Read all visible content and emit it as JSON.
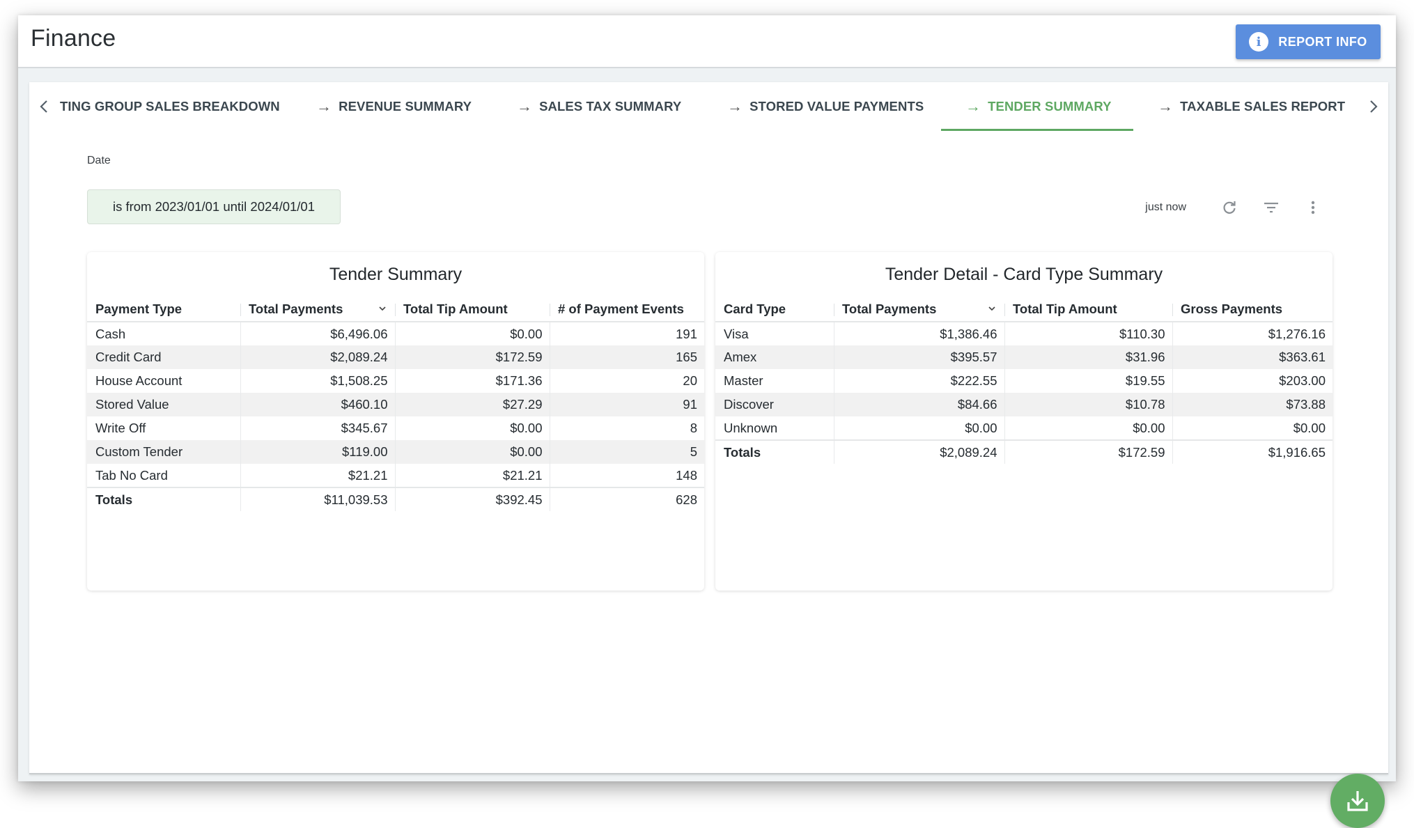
{
  "app": {
    "title": "Finance",
    "report_info_label": "REPORT INFO"
  },
  "tabs": [
    {
      "label": "TING GROUP SALES BREAKDOWN",
      "active": false
    },
    {
      "label": "REVENUE SUMMARY",
      "active": false
    },
    {
      "label": "SALES TAX SUMMARY",
      "active": false
    },
    {
      "label": "STORED VALUE PAYMENTS",
      "active": false
    },
    {
      "label": "TENDER SUMMARY",
      "active": true
    },
    {
      "label": "TAXABLE SALES REPORT",
      "active": false
    }
  ],
  "icons": {
    "tab_scroll_left": "chevron-left",
    "tab_scroll_right": "chevron-right",
    "tab_arrow": "→",
    "refresh": "refresh",
    "filter": "filter",
    "more": "more-vertical",
    "download": "download",
    "info": "i",
    "sort": "⌄"
  },
  "filter": {
    "label": "Date",
    "value": "is from 2023/01/01 until 2024/01/01"
  },
  "toolbar": {
    "updated_text": "just now"
  },
  "colors": {
    "accent_green": "#5ea862",
    "button_blue": "#5b8ede",
    "filter_bg": "#e9f4ea",
    "fab_green": "#62ad64"
  },
  "tender_summary": {
    "title": "Tender Summary",
    "columns": [
      "Payment Type",
      "Total Payments",
      "Total Tip Amount",
      "# of Payment Events"
    ],
    "sorted_column": "Total Payments",
    "rows": [
      [
        "Cash",
        "$6,496.06",
        "$0.00",
        "191"
      ],
      [
        "Credit Card",
        "$2,089.24",
        "$172.59",
        "165"
      ],
      [
        "House Account",
        "$1,508.25",
        "$171.36",
        "20"
      ],
      [
        "Stored Value",
        "$460.10",
        "$27.29",
        "91"
      ],
      [
        "Write Off",
        "$345.67",
        "$0.00",
        "8"
      ],
      [
        "Custom Tender",
        "$119.00",
        "$0.00",
        "5"
      ],
      [
        "Tab No Card",
        "$21.21",
        "$21.21",
        "148"
      ]
    ],
    "totals": [
      "Totals",
      "$11,039.53",
      "$392.45",
      "628"
    ]
  },
  "card_type_summary": {
    "title": "Tender Detail - Card Type Summary",
    "columns": [
      "Card Type",
      "Total Payments",
      "Total Tip Amount",
      "Gross Payments"
    ],
    "sorted_column": "Total Payments",
    "rows": [
      [
        "Visa",
        "$1,386.46",
        "$110.30",
        "$1,276.16"
      ],
      [
        "Amex",
        "$395.57",
        "$31.96",
        "$363.61"
      ],
      [
        "Master",
        "$222.55",
        "$19.55",
        "$203.00"
      ],
      [
        "Discover",
        "$84.66",
        "$10.78",
        "$73.88"
      ],
      [
        "Unknown",
        "$0.00",
        "$0.00",
        "$0.00"
      ]
    ],
    "totals": [
      "Totals",
      "$2,089.24",
      "$172.59",
      "$1,916.65"
    ]
  }
}
